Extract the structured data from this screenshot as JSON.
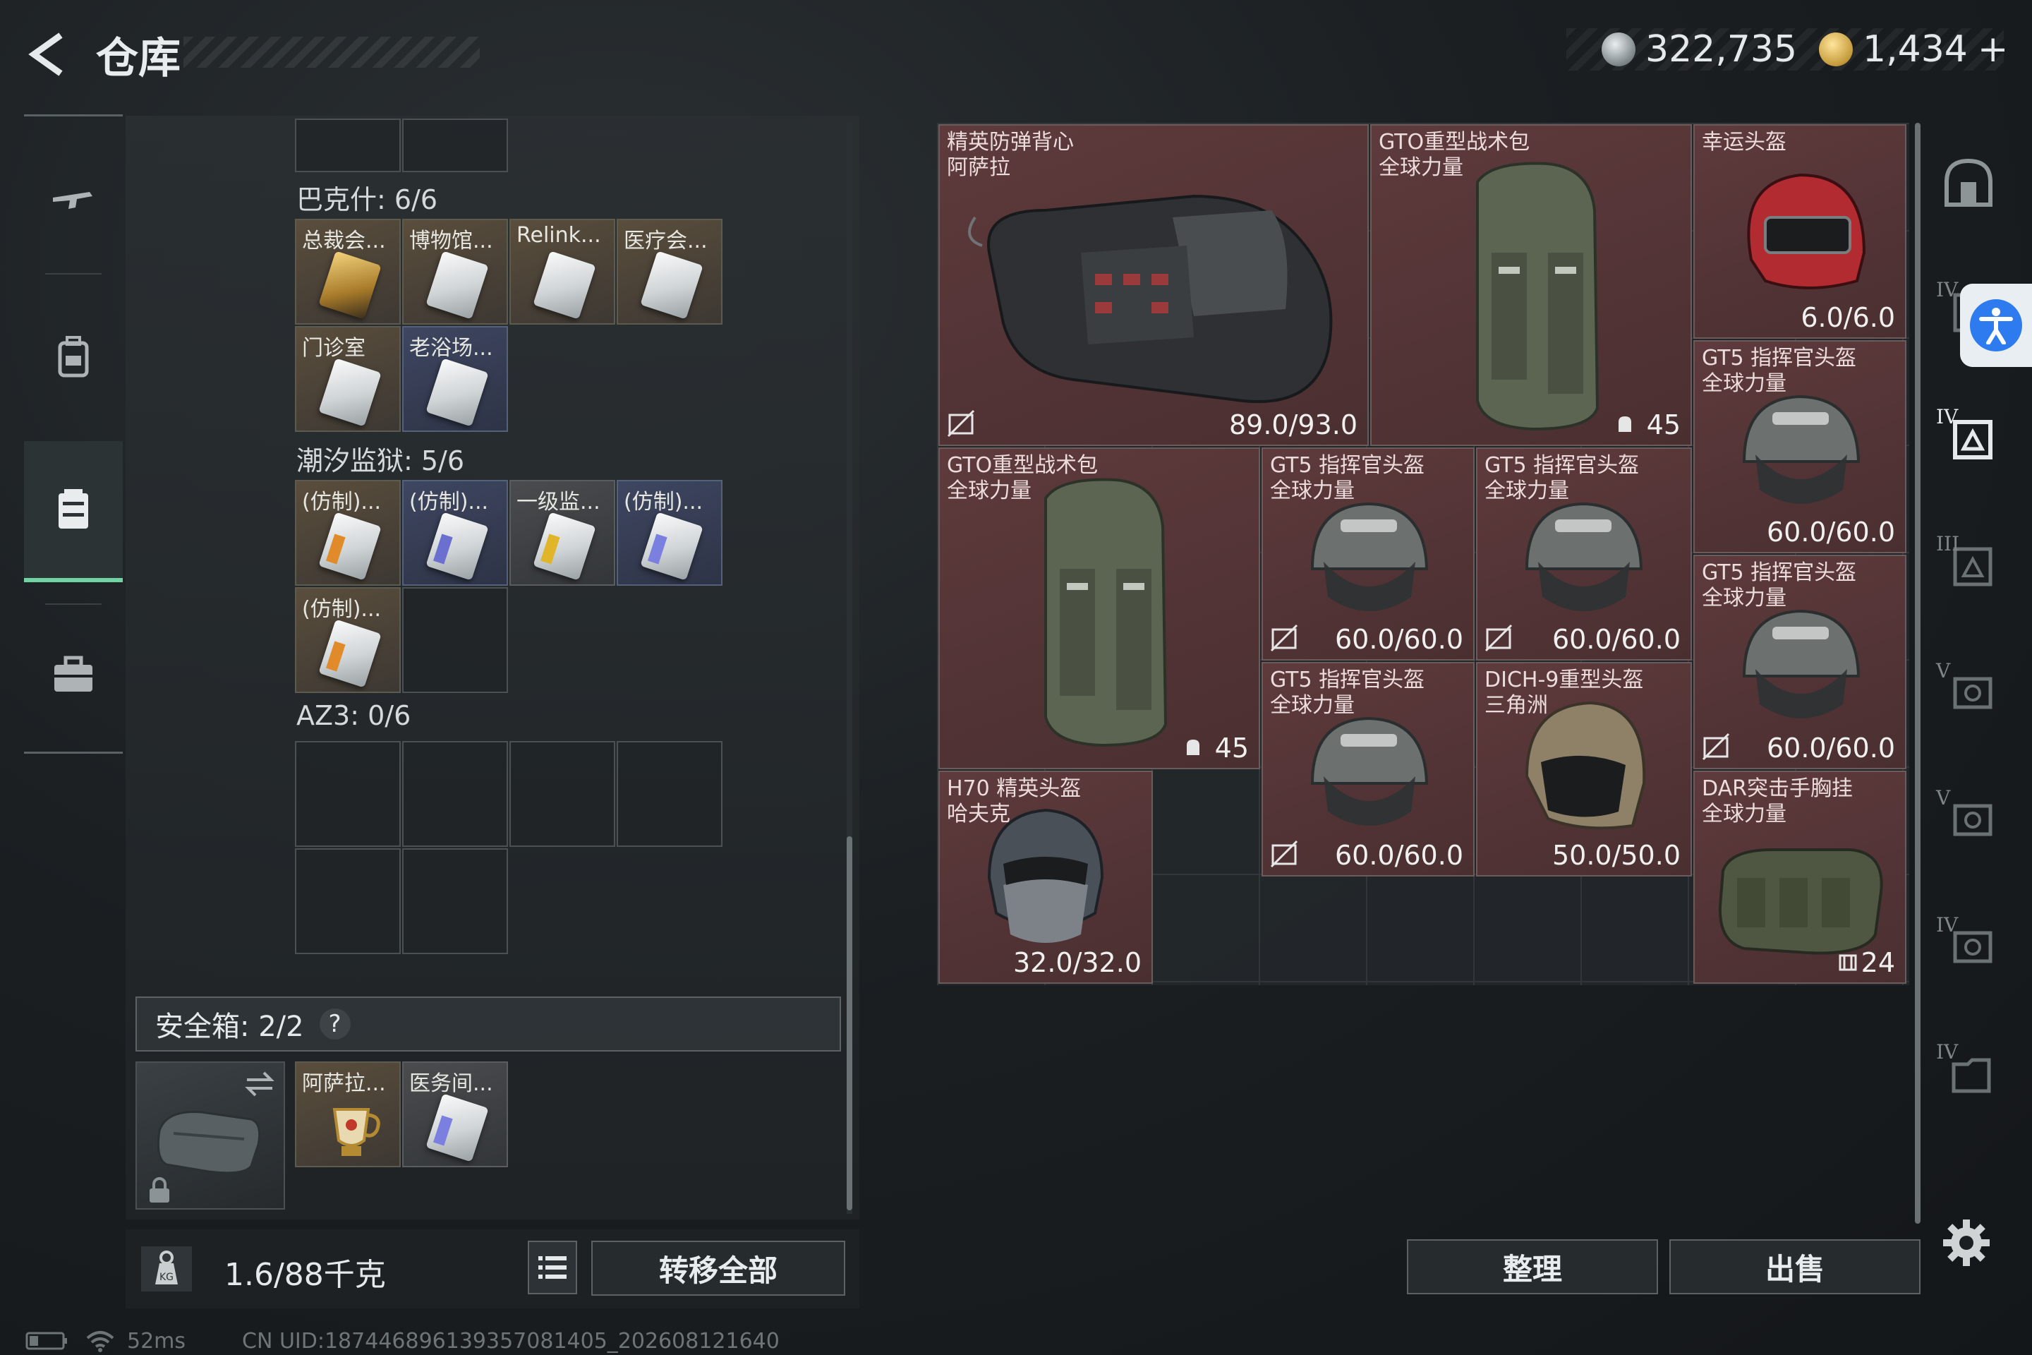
{
  "header": {
    "title": "仓库",
    "silver_amount": "322,735",
    "gold_amount": "1,434",
    "gold_plus": "+"
  },
  "left_nav": {
    "items": [
      {
        "icon": "rifle-icon",
        "active": false
      },
      {
        "icon": "backpack-icon",
        "active": false
      },
      {
        "icon": "chest-rig-icon",
        "active": true
      },
      {
        "icon": "briefcase-icon",
        "active": false
      }
    ]
  },
  "backpack": {
    "sections": [
      {
        "label": "巴克什: 6/6",
        "items": [
          "总裁会...",
          "博物馆...",
          "Relink...",
          "医疗会...",
          "门诊室",
          "老浴场..."
        ]
      },
      {
        "label": "潮汐监狱: 5/6",
        "items": [
          "(仿制)...",
          "(仿制)...",
          "一级监...",
          "(仿制)...",
          "(仿制)..."
        ]
      },
      {
        "label": "AZ3: 0/6",
        "items": []
      }
    ],
    "safebox": {
      "label": "安全箱:  2/2",
      "help": "?",
      "items": [
        "阿萨拉...",
        "医务间..."
      ]
    },
    "weight": "1.6/88千克",
    "transfer_all": "转移全部"
  },
  "stash": {
    "items": [
      {
        "name": "精英防弹背心\n阿萨拉",
        "value": "89.0/93.0"
      },
      {
        "name": "GTO重型战术包\n全球力量",
        "value": "45"
      },
      {
        "name": "幸运头盔",
        "value": "6.0/6.0"
      },
      {
        "name": "GT5 指挥官头盔\n全球力量",
        "value": "60.0/60.0"
      },
      {
        "name": "GTO重型战术包\n全球力量",
        "value": "45"
      },
      {
        "name": "GT5 指挥官头盔\n全球力量",
        "value": "60.0/60.0"
      },
      {
        "name": "GT5 指挥官头盔\n全球力量",
        "value": "60.0/60.0"
      },
      {
        "name": "GT5 指挥官头盔\n全球力量",
        "value": "60.0/60.0"
      },
      {
        "name": "GT5 指挥官头盔\n全球力量",
        "value": "60.0/60.0"
      },
      {
        "name": "DICH-9重型头盔\n三角洲",
        "value": "50.0/50.0"
      },
      {
        "name": "H70 精英头盔\n哈夫克",
        "value": "32.0/32.0"
      },
      {
        "name": "DAR突击手胸挂\n全球力量",
        "value": "24"
      }
    ],
    "sort_label": "整理",
    "sell_label": "出售"
  },
  "filters": [
    "IV",
    "IV",
    "III",
    "V",
    "V",
    "IV",
    "IV"
  ],
  "status": {
    "ping": "52ms",
    "uid": "CN UID:18744689613935708140​5_202608121640"
  },
  "colors": {
    "accent": "#6fd3a4",
    "item_red": "#5e3a3c",
    "access_blue": "#2e7bf0"
  }
}
